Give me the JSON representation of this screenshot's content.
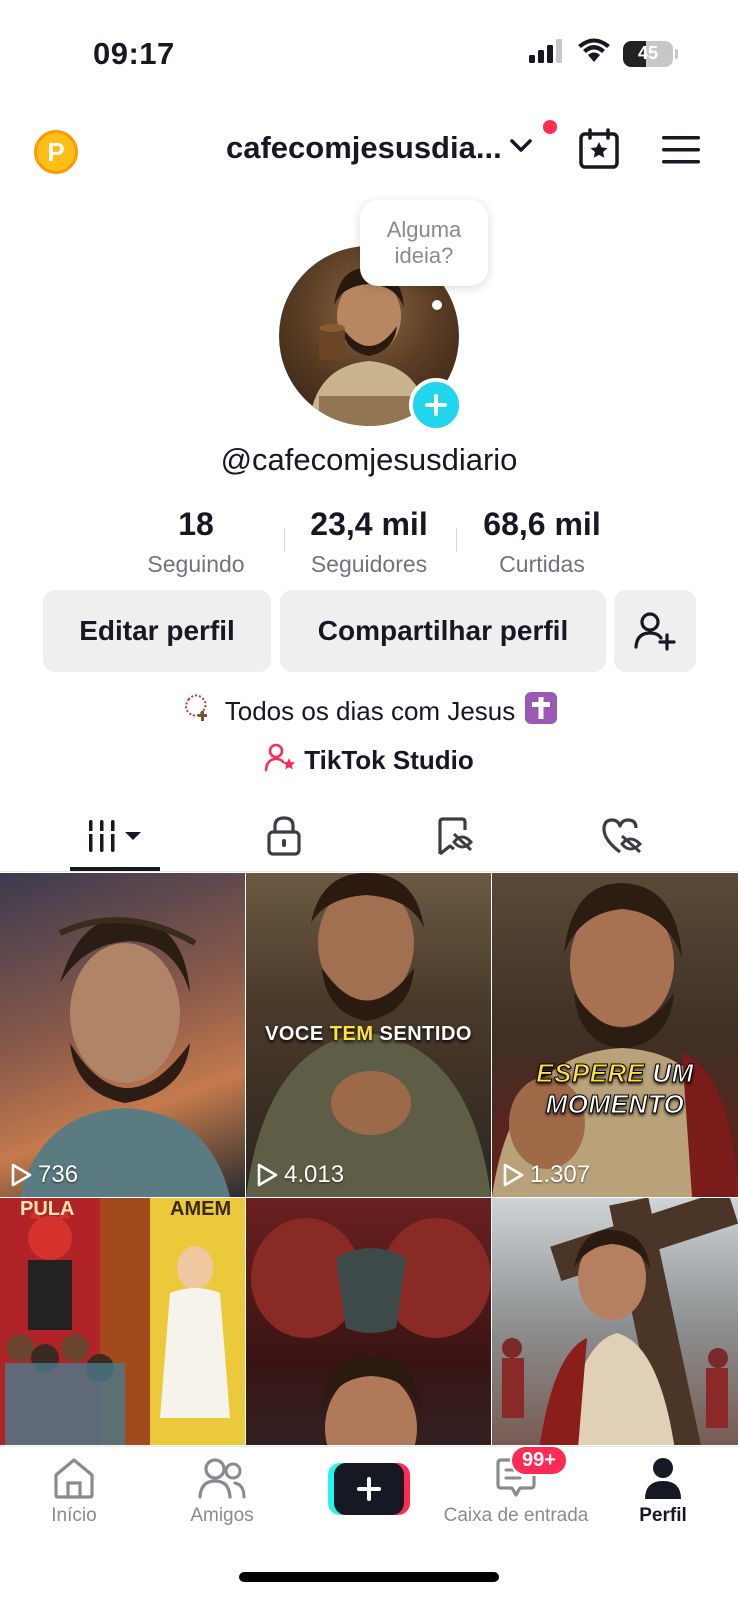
{
  "status_bar": {
    "time": "09:17",
    "battery_level": "45",
    "battery_fraction": 0.45,
    "icons": [
      "cellular-signal-icon",
      "wifi-icon",
      "battery-icon"
    ]
  },
  "header": {
    "coin_letter": "P",
    "username": "cafecomjesusdia...",
    "has_notification": true
  },
  "profile": {
    "bubble_text": "Alguma ideia?",
    "handle": "@cafecomjesusdiario",
    "bio": "Todos os dias com Jesus",
    "studio_label": "TikTok Studio"
  },
  "stats": [
    {
      "value": "18",
      "label": "Seguindo"
    },
    {
      "value": "23,4 mil",
      "label": "Seguidores"
    },
    {
      "value": "68,6 mil",
      "label": "Curtidas"
    }
  ],
  "buttons": {
    "edit": "Editar perfil",
    "share": "Compartilhar perfil"
  },
  "tabs": [
    {
      "icon": "videos-grid-icon",
      "active": true
    },
    {
      "icon": "lock-icon",
      "active": false
    },
    {
      "icon": "saved-icon",
      "active": false
    },
    {
      "icon": "liked-icon",
      "active": false
    }
  ],
  "videos": [
    {
      "views": "736",
      "overlay": ""
    },
    {
      "views": "4.013",
      "overlay_parts": [
        "VOCE ",
        "TEM",
        " SENTIDO"
      ]
    },
    {
      "views": "1.307",
      "overlay_parts": [
        "ESPERE",
        " UM MOMENTO"
      ]
    },
    {
      "views": "",
      "signs": [
        "PULA",
        "AMEM"
      ]
    },
    {
      "views": ""
    },
    {
      "views": ""
    }
  ],
  "bottom_nav": [
    {
      "label": "Início",
      "icon": "home-icon"
    },
    {
      "label": "Amigos",
      "icon": "friends-icon"
    },
    {
      "label": "",
      "icon": "create-icon"
    },
    {
      "label": "Caixa de entrada",
      "icon": "inbox-icon",
      "badge": "99+"
    },
    {
      "label": "Perfil",
      "icon": "profile-icon",
      "active": true
    }
  ],
  "colors": {
    "accent_red": "#fe2c55",
    "accent_cyan": "#25f4ee",
    "avatar_add": "#20d5ec",
    "coin": "#ffbe18"
  }
}
